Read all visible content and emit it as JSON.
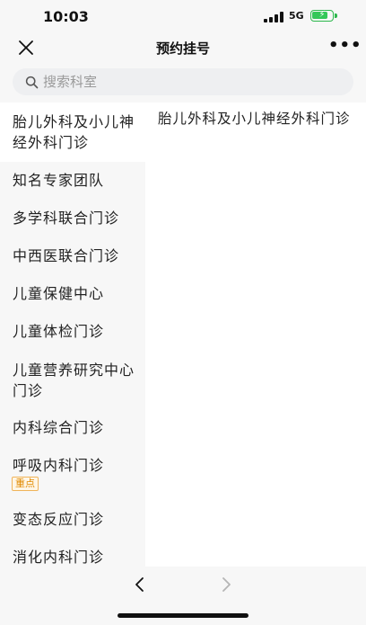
{
  "status_bar": {
    "time": "10:03",
    "network": "5G",
    "battery_level": 0.85
  },
  "nav": {
    "title": "预约挂号",
    "more_label": "•••"
  },
  "search": {
    "placeholder": "搜索科室",
    "value": ""
  },
  "sidebar": {
    "items": [
      {
        "label": "胎儿外科及小儿神经外科门诊",
        "active": true
      },
      {
        "label": "知名专家团队"
      },
      {
        "label": "多学科联合门诊"
      },
      {
        "label": "中西医联合门诊"
      },
      {
        "label": "儿童保健中心"
      },
      {
        "label": "儿童体检门诊"
      },
      {
        "label": "儿童营养研究中心门诊"
      },
      {
        "label": "内科综合门诊"
      },
      {
        "label": "呼吸内科门诊",
        "tag": "重点"
      },
      {
        "label": "变态反应门诊"
      },
      {
        "label": "消化内科门诊"
      }
    ]
  },
  "content": {
    "title": "胎儿外科及小儿神经外科门诊"
  },
  "colors": {
    "accent": "#e08a00",
    "battery": "#34c759",
    "sidebar_bg": "#f7f7f7"
  },
  "icons": {
    "close": "close-icon",
    "search": "search-icon",
    "back": "chevron-left-icon",
    "forward": "chevron-right-icon"
  }
}
